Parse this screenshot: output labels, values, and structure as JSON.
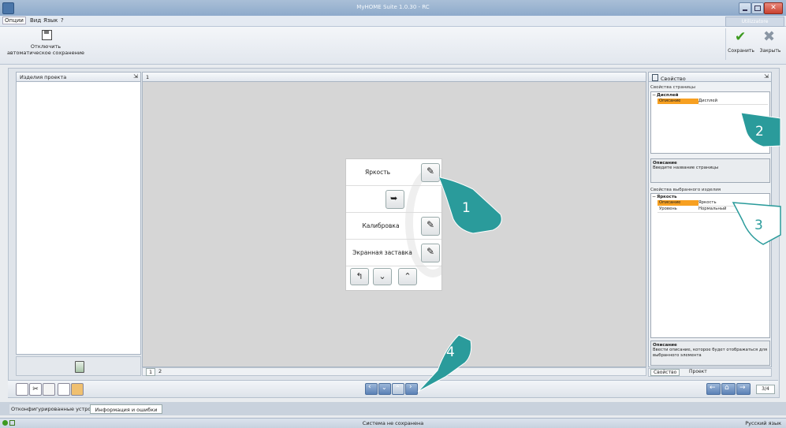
{
  "window": {
    "title": "MyHOME Suite 1.0.30 - RC",
    "user_label": "Utilizzatore"
  },
  "menu": {
    "items": [
      "Опции",
      "Вид",
      "Язык",
      "?"
    ]
  },
  "ribbon": {
    "autosave_line1": "Отключить",
    "autosave_line2": "автоматическое сохранение",
    "save_label": "Сохранить",
    "close_label": "Закрыть"
  },
  "left_panel": {
    "title": "Изделия проекта",
    "pin": "⇲"
  },
  "center": {
    "tab_number": "1",
    "pages": [
      "1",
      "2"
    ]
  },
  "device_screen": {
    "brightness_label": "Яркость",
    "calibration_label": "Калибровка",
    "screensaver_label": "Экранная заставка"
  },
  "callouts": [
    "1",
    "2",
    "3",
    "4"
  ],
  "right_panel": {
    "title": "Свойство",
    "page_props_label": "Свойства страницы",
    "display_group": "Дисплей",
    "display_desc_key": "Описание",
    "display_desc_val": "Дисплей",
    "desc_box_title": "Описание",
    "desc_box_text": "Введите название страницы",
    "selected_props_label": "Свойства выбранного изделия",
    "brightness_group": "Яркость",
    "brightness_desc_key": "Описание",
    "brightness_desc_val": "Яркость",
    "level_key": "Уровень",
    "level_val": "Нормальный",
    "desc2_title": "Описание",
    "desc2_text": "Ввести описание, которое будет отображаться для выбранного элемента",
    "tab_property": "Свойство",
    "tab_project": "Проект"
  },
  "bottom_toolbar": {
    "page_counter": "3/4"
  },
  "bottom_tabs": {
    "configured": "Отконфигурированные устройст",
    "info": "Информация и ошибки"
  },
  "status": {
    "center": "Система не сохранена",
    "right": "Русский язык"
  },
  "colors": {
    "accent_orange": "#f7a021",
    "callout_teal": "#2a9b9b",
    "titlebar": "#9db4d0"
  }
}
